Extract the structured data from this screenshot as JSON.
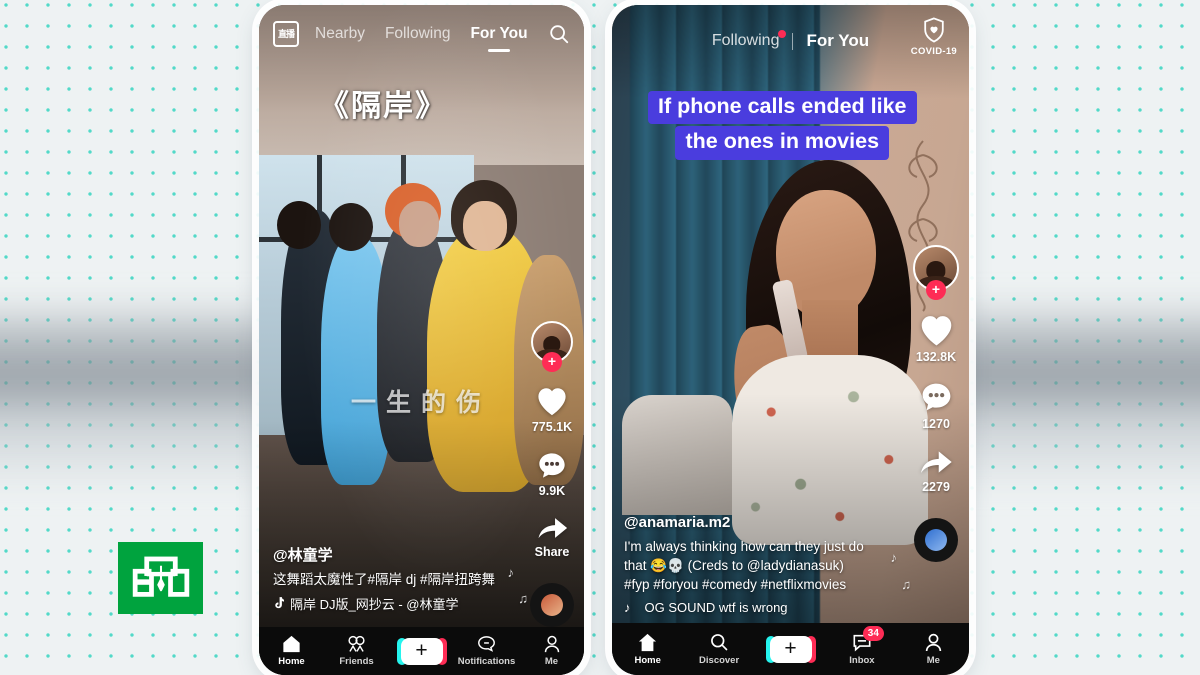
{
  "background": {
    "dot_color": "#36d4c0",
    "base_color": "#eef2f3"
  },
  "watermark": {
    "name": "ntv-logo",
    "text": "НТВ",
    "color": "#00a33e"
  },
  "left_phone": {
    "top_bar": {
      "live_icon_label": "直播",
      "tabs": [
        {
          "label": "Nearby",
          "active": false
        },
        {
          "label": "Following",
          "active": false
        },
        {
          "label": "For You",
          "active": true
        }
      ],
      "search_icon": "search-icon"
    },
    "video": {
      "title_overlay": "《隔岸》",
      "lyric_overlay": "一生的伤"
    },
    "rail": {
      "avatar_plus": "+",
      "like_count": "775.1K",
      "comment_count": "9.9K",
      "share_label": "Share"
    },
    "meta": {
      "handle": "@林童学",
      "description": "这舞蹈太魔性了#隔岸 dj #隔岸扭跨舞",
      "song": "隔岸 DJ版_网抄云 - @林童学"
    },
    "nav": [
      {
        "label": "Home",
        "icon": "home-icon",
        "active": true
      },
      {
        "label": "Friends",
        "icon": "friends-icon",
        "active": false
      },
      {
        "label": "",
        "icon": "create-icon",
        "active": false
      },
      {
        "label": "Notifications",
        "icon": "notifications-icon",
        "active": false
      },
      {
        "label": "Me",
        "icon": "profile-icon",
        "active": false
      }
    ],
    "create_label": "+"
  },
  "right_phone": {
    "top_bar": {
      "tabs": [
        {
          "label": "Following",
          "active": false
        },
        {
          "label": "For You",
          "active": true
        }
      ],
      "covid_label": "COVID-19",
      "covid_icon": "shield-heart-icon"
    },
    "video": {
      "caption_line1": "If phone calls ended like",
      "caption_line2": "the ones in movies",
      "caption_bg": "#4a3dde"
    },
    "rail": {
      "avatar_plus": "+",
      "like_count": "132.8K",
      "comment_count": "1270",
      "share_count": "2279"
    },
    "meta": {
      "handle": "@anamaria.m2",
      "description_line1": "I'm always thinking how can they just do",
      "description_line2": "that 😂💀 (Creds to @ladydianasuk)",
      "description_line3": "#fyp #foryou #comedy #netflixmovies",
      "song": "OG SOUND wtf is wrong"
    },
    "nav": [
      {
        "label": "Home",
        "icon": "home-icon",
        "active": true
      },
      {
        "label": "Discover",
        "icon": "search-icon",
        "active": false
      },
      {
        "label": "",
        "icon": "create-icon",
        "active": false
      },
      {
        "label": "Inbox",
        "icon": "inbox-icon",
        "active": false,
        "badge": "34"
      },
      {
        "label": "Me",
        "icon": "profile-icon",
        "active": false
      }
    ],
    "create_label": "+"
  }
}
